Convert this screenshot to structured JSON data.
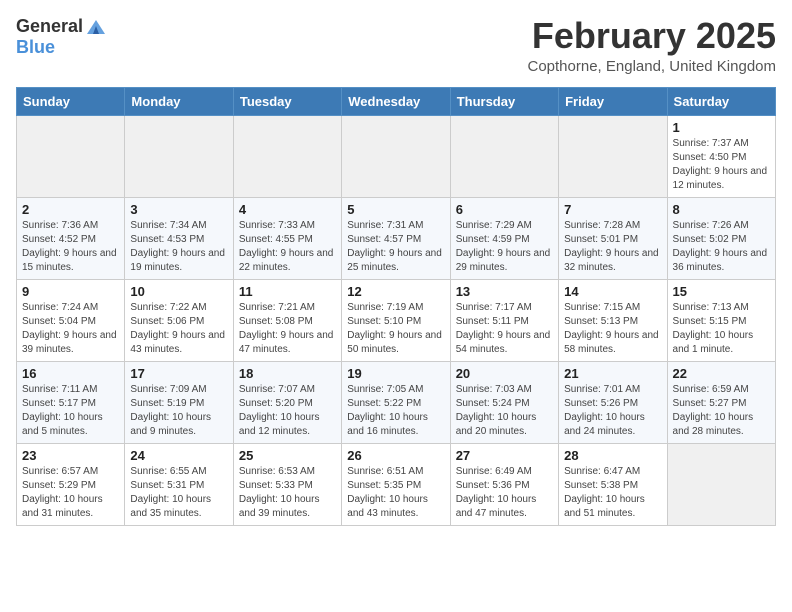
{
  "header": {
    "logo_general": "General",
    "logo_blue": "Blue",
    "month_title": "February 2025",
    "location": "Copthorne, England, United Kingdom"
  },
  "weekdays": [
    "Sunday",
    "Monday",
    "Tuesday",
    "Wednesday",
    "Thursday",
    "Friday",
    "Saturday"
  ],
  "weeks": [
    [
      {
        "day": "",
        "info": ""
      },
      {
        "day": "",
        "info": ""
      },
      {
        "day": "",
        "info": ""
      },
      {
        "day": "",
        "info": ""
      },
      {
        "day": "",
        "info": ""
      },
      {
        "day": "",
        "info": ""
      },
      {
        "day": "1",
        "info": "Sunrise: 7:37 AM\nSunset: 4:50 PM\nDaylight: 9 hours and 12 minutes."
      }
    ],
    [
      {
        "day": "2",
        "info": "Sunrise: 7:36 AM\nSunset: 4:52 PM\nDaylight: 9 hours and 15 minutes."
      },
      {
        "day": "3",
        "info": "Sunrise: 7:34 AM\nSunset: 4:53 PM\nDaylight: 9 hours and 19 minutes."
      },
      {
        "day": "4",
        "info": "Sunrise: 7:33 AM\nSunset: 4:55 PM\nDaylight: 9 hours and 22 minutes."
      },
      {
        "day": "5",
        "info": "Sunrise: 7:31 AM\nSunset: 4:57 PM\nDaylight: 9 hours and 25 minutes."
      },
      {
        "day": "6",
        "info": "Sunrise: 7:29 AM\nSunset: 4:59 PM\nDaylight: 9 hours and 29 minutes."
      },
      {
        "day": "7",
        "info": "Sunrise: 7:28 AM\nSunset: 5:01 PM\nDaylight: 9 hours and 32 minutes."
      },
      {
        "day": "8",
        "info": "Sunrise: 7:26 AM\nSunset: 5:02 PM\nDaylight: 9 hours and 36 minutes."
      }
    ],
    [
      {
        "day": "9",
        "info": "Sunrise: 7:24 AM\nSunset: 5:04 PM\nDaylight: 9 hours and 39 minutes."
      },
      {
        "day": "10",
        "info": "Sunrise: 7:22 AM\nSunset: 5:06 PM\nDaylight: 9 hours and 43 minutes."
      },
      {
        "day": "11",
        "info": "Sunrise: 7:21 AM\nSunset: 5:08 PM\nDaylight: 9 hours and 47 minutes."
      },
      {
        "day": "12",
        "info": "Sunrise: 7:19 AM\nSunset: 5:10 PM\nDaylight: 9 hours and 50 minutes."
      },
      {
        "day": "13",
        "info": "Sunrise: 7:17 AM\nSunset: 5:11 PM\nDaylight: 9 hours and 54 minutes."
      },
      {
        "day": "14",
        "info": "Sunrise: 7:15 AM\nSunset: 5:13 PM\nDaylight: 9 hours and 58 minutes."
      },
      {
        "day": "15",
        "info": "Sunrise: 7:13 AM\nSunset: 5:15 PM\nDaylight: 10 hours and 1 minute."
      }
    ],
    [
      {
        "day": "16",
        "info": "Sunrise: 7:11 AM\nSunset: 5:17 PM\nDaylight: 10 hours and 5 minutes."
      },
      {
        "day": "17",
        "info": "Sunrise: 7:09 AM\nSunset: 5:19 PM\nDaylight: 10 hours and 9 minutes."
      },
      {
        "day": "18",
        "info": "Sunrise: 7:07 AM\nSunset: 5:20 PM\nDaylight: 10 hours and 12 minutes."
      },
      {
        "day": "19",
        "info": "Sunrise: 7:05 AM\nSunset: 5:22 PM\nDaylight: 10 hours and 16 minutes."
      },
      {
        "day": "20",
        "info": "Sunrise: 7:03 AM\nSunset: 5:24 PM\nDaylight: 10 hours and 20 minutes."
      },
      {
        "day": "21",
        "info": "Sunrise: 7:01 AM\nSunset: 5:26 PM\nDaylight: 10 hours and 24 minutes."
      },
      {
        "day": "22",
        "info": "Sunrise: 6:59 AM\nSunset: 5:27 PM\nDaylight: 10 hours and 28 minutes."
      }
    ],
    [
      {
        "day": "23",
        "info": "Sunrise: 6:57 AM\nSunset: 5:29 PM\nDaylight: 10 hours and 31 minutes."
      },
      {
        "day": "24",
        "info": "Sunrise: 6:55 AM\nSunset: 5:31 PM\nDaylight: 10 hours and 35 minutes."
      },
      {
        "day": "25",
        "info": "Sunrise: 6:53 AM\nSunset: 5:33 PM\nDaylight: 10 hours and 39 minutes."
      },
      {
        "day": "26",
        "info": "Sunrise: 6:51 AM\nSunset: 5:35 PM\nDaylight: 10 hours and 43 minutes."
      },
      {
        "day": "27",
        "info": "Sunrise: 6:49 AM\nSunset: 5:36 PM\nDaylight: 10 hours and 47 minutes."
      },
      {
        "day": "28",
        "info": "Sunrise: 6:47 AM\nSunset: 5:38 PM\nDaylight: 10 hours and 51 minutes."
      },
      {
        "day": "",
        "info": ""
      }
    ]
  ]
}
